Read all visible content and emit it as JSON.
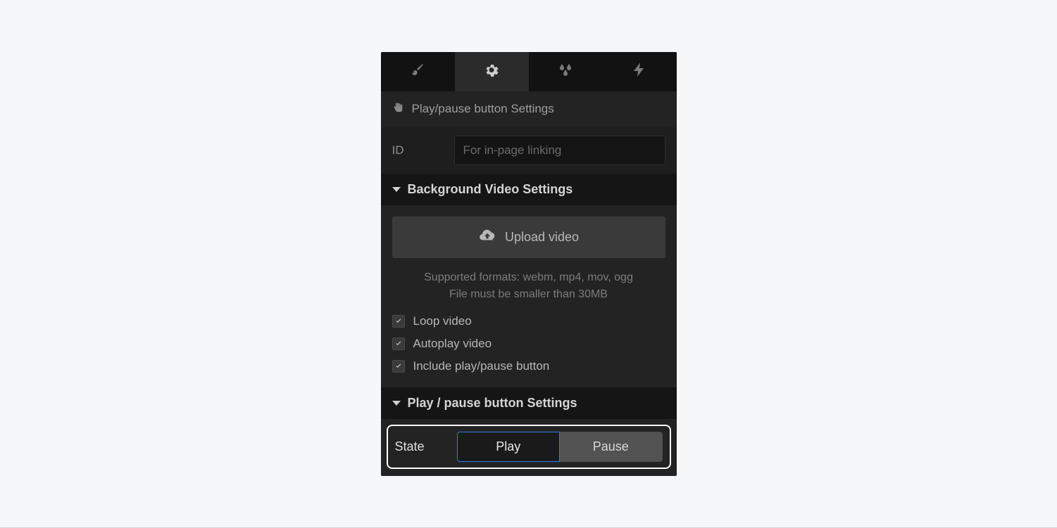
{
  "crumb": {
    "title": "Play/pause button Settings"
  },
  "id_row": {
    "label": "ID",
    "placeholder": "For in-page linking"
  },
  "sections": {
    "bg_video": {
      "title": "Background Video Settings",
      "upload_label": "Upload video",
      "note_line1": "Supported formats: webm, mp4, mov, ogg",
      "note_line2": "File must be smaller than 30MB",
      "checks": {
        "loop": {
          "label": "Loop video",
          "checked": true
        },
        "autoplay": {
          "label": "Autoplay video",
          "checked": true
        },
        "include_btn": {
          "label": "Include play/pause button",
          "checked": true
        }
      }
    },
    "play_pause": {
      "title": "Play / pause button Settings",
      "state_label": "State",
      "play": "Play",
      "pause": "Pause",
      "selected": "Play"
    }
  }
}
